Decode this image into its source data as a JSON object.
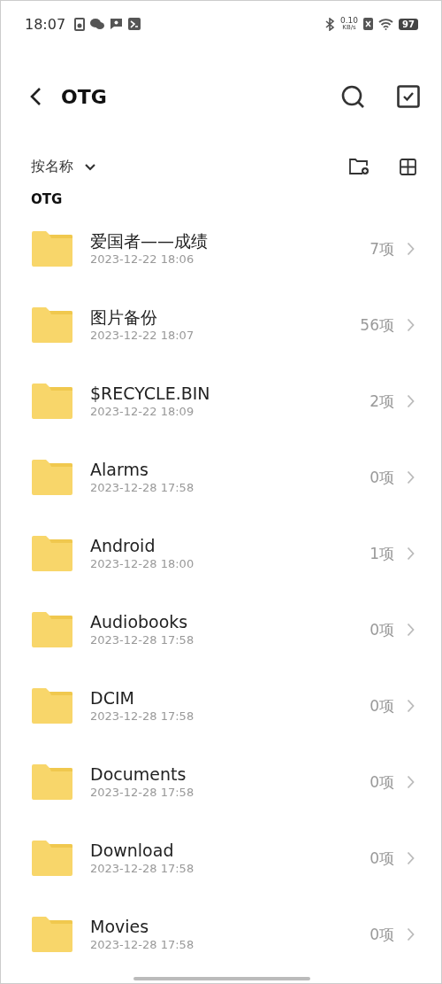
{
  "status_bar": {
    "time": "18:07",
    "speed_value": "0.10",
    "speed_unit": "KB/s",
    "battery": "97"
  },
  "header": {
    "title": "OTG"
  },
  "toolbar": {
    "sort_label": "按名称"
  },
  "path": "OTG",
  "folders": [
    {
      "name": "爱国者——成绩",
      "modified": "2023-12-22 18:06",
      "count": "7项"
    },
    {
      "name": "图片备份",
      "modified": "2023-12-22 18:07",
      "count": "56项"
    },
    {
      "name": "$RECYCLE.BIN",
      "modified": "2023-12-22 18:09",
      "count": "2项"
    },
    {
      "name": "Alarms",
      "modified": "2023-12-28 17:58",
      "count": "0项"
    },
    {
      "name": "Android",
      "modified": "2023-12-28 18:00",
      "count": "1项"
    },
    {
      "name": "Audiobooks",
      "modified": "2023-12-28 17:58",
      "count": "0项"
    },
    {
      "name": "DCIM",
      "modified": "2023-12-28 17:58",
      "count": "0项"
    },
    {
      "name": "Documents",
      "modified": "2023-12-28 17:58",
      "count": "0项"
    },
    {
      "name": "Download",
      "modified": "2023-12-28 17:58",
      "count": "0项"
    },
    {
      "name": "Movies",
      "modified": "2023-12-28 17:58",
      "count": "0项"
    }
  ]
}
